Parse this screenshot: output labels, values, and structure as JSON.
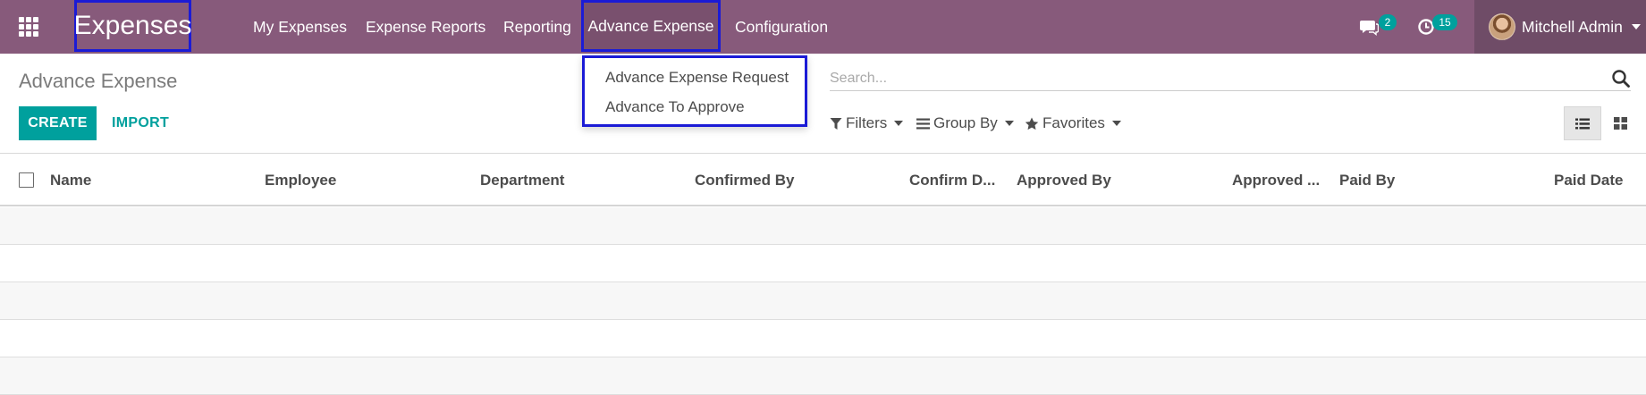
{
  "navbar": {
    "brand": "Expenses",
    "menu": [
      {
        "label": "My Expenses"
      },
      {
        "label": "Expense Reports"
      },
      {
        "label": "Reporting"
      },
      {
        "label": "Advance Expense"
      },
      {
        "label": "Configuration"
      }
    ],
    "messages_count": "2",
    "activities_count": "15",
    "user_name": "Mitchell Admin"
  },
  "dropdown": {
    "items": [
      {
        "label": "Advance Expense Request"
      },
      {
        "label": "Advance To Approve"
      }
    ]
  },
  "control_panel": {
    "breadcrumb": "Advance Expense",
    "create_label": "CREATE",
    "import_label": "IMPORT",
    "search_placeholder": "Search...",
    "filters_label": "Filters",
    "group_by_label": "Group By",
    "favorites_label": "Favorites"
  },
  "list": {
    "columns": [
      "Name",
      "Employee",
      "Department",
      "Confirmed By",
      "Confirm D...",
      "Approved By",
      "Approved ...",
      "Paid By",
      "Paid Date"
    ]
  },
  "colors": {
    "navbar": "#875a7b",
    "primary": "#00a09d",
    "highlight_border": "#1b1bd6"
  }
}
